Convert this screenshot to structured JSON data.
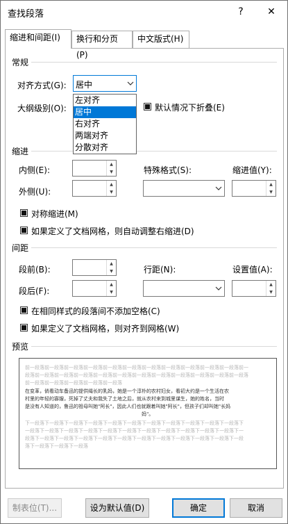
{
  "window": {
    "title": "查找段落",
    "help": "?",
    "close": "✕"
  },
  "tabs": [
    {
      "label": "缩进和间距(I)"
    },
    {
      "label": "换行和分页(P)"
    },
    {
      "label": "中文版式(H)"
    }
  ],
  "general": {
    "heading": "常规",
    "align_label": "对齐方式(G):",
    "align_value": "居中",
    "align_options": [
      "左对齐",
      "居中",
      "右对齐",
      "两端对齐",
      "分散对齐"
    ],
    "outline_label": "大纲级别(O):",
    "collapse_label": "默认情况下折叠(E)"
  },
  "indent": {
    "heading": "缩进",
    "inside_label": "内侧(E):",
    "outside_label": "外侧(U):",
    "special_label": "特殊格式(S):",
    "indent_value_label": "缩进值(Y):",
    "mirror_label": "对称缩进(M)",
    "grid_adjust_label": "如果定义了文档网格，则自动调整右缩进(D)"
  },
  "spacing": {
    "heading": "间距",
    "before_label": "段前(B):",
    "after_label": "段后(F):",
    "line_label": "行距(N):",
    "set_value_label": "设置值(A):",
    "no_space_label": "在相同样式的段落间不添加空格(C)",
    "snap_grid_label": "如果定义了文档网格，则对齐到网格(W)"
  },
  "preview": {
    "heading": "预览",
    "lines": [
      {
        "text": "前一段落前一段落前一段落前一段落前一段落前一段落前一段落前一段落前一段落前一段落前一段落前一",
        "tone": "gray"
      },
      {
        "text": "段落前一段落前一段落前一段落前一段落前一段落前一段落前一段落前一段落前一段落前一段落前一段落",
        "tone": "gray"
      },
      {
        "text": "前一段落前一段落前一段落前一段落前一段落",
        "tone": "gray"
      },
      {
        "text": "在变革，倘看动车备迅的提供绳长的乳妈，她是一个淳朴的农村妇女，看初大约是一个生活在农",
        "tone": "dark"
      },
      {
        "text": "村里的年轻的寡嫂，死掉了丈夫和我失了土地之后，就从农村来到城里谋生，她的姓名，当时",
        "tone": "dark"
      },
      {
        "text": "是没有人知道的，鲁迅的祖母叫她\"阿长\"，因此人们也就跟着叫她\"阿长\"，但孩子们却叫她\"长妈",
        "tone": "dark"
      },
      {
        "text": "妈\"。",
        "tone": "dark"
      },
      {
        "text": "下一段落下一段落下一段落下一段落下一段落下一段落下一段落下一段落下一段落下一段落下一段落下",
        "tone": "gray"
      },
      {
        "text": "一段落下一段落下一段落下一段落下一段落下一段落下一段落下一段落下一段落下一段落下一段落下一",
        "tone": "gray"
      },
      {
        "text": "段落下一段落下一段落下一段落下一段落下一段落下一段落下一段落下一段落下一段落下一段落下一段",
        "tone": "gray"
      },
      {
        "text": "落下一段落下一段落下一段落",
        "tone": "gray"
      }
    ]
  },
  "buttons": {
    "tabs": "制表位(T)...",
    "set_default": "设为默认值(D)",
    "ok": "确定",
    "cancel": "取消"
  },
  "colors": {
    "accent": "#0078d7",
    "border": "#adadad"
  }
}
